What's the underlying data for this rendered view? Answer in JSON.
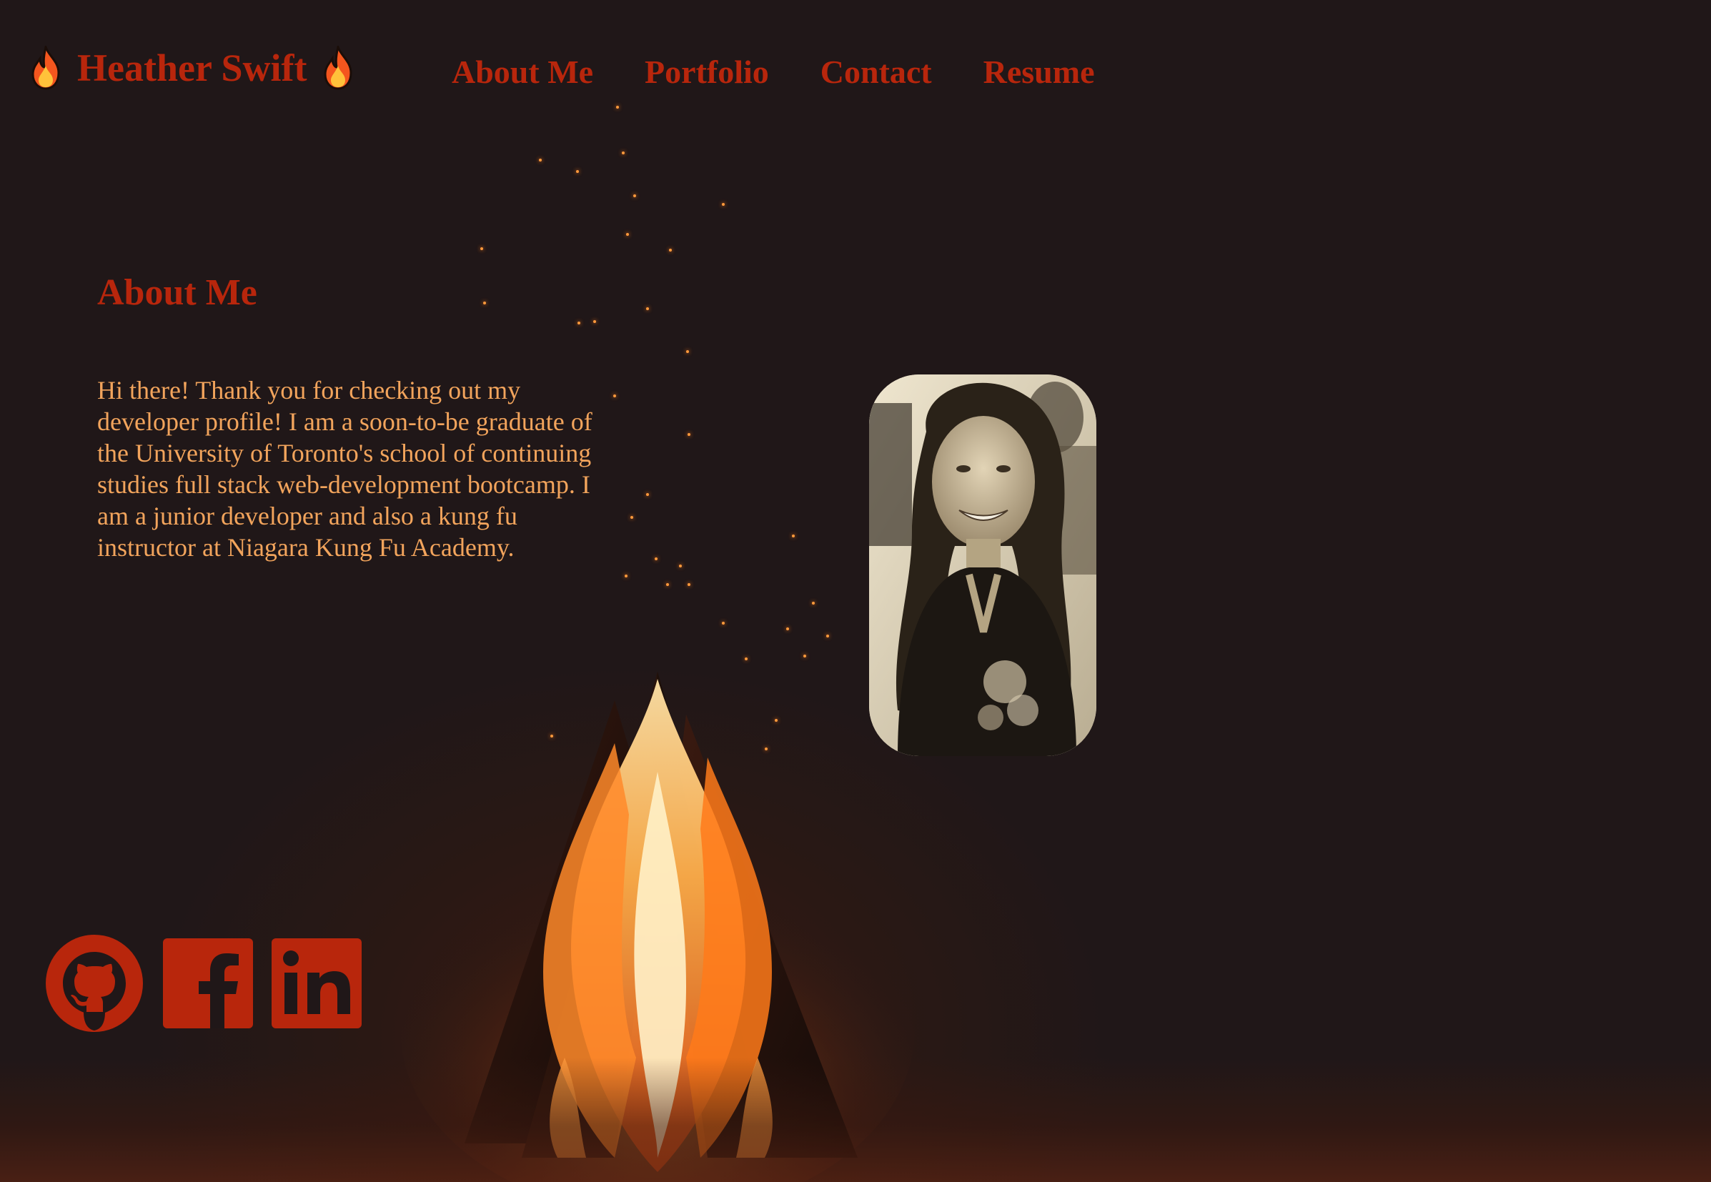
{
  "header": {
    "brand_name": "Heather Swift",
    "brand_icon": "fire-icon",
    "nav": [
      {
        "label": "About Me"
      },
      {
        "label": "Portfolio"
      },
      {
        "label": "Contact"
      },
      {
        "label": "Resume"
      }
    ]
  },
  "about": {
    "title": "About Me",
    "body": "Hi there! Thank you for checking out my developer profile! I am a soon-to-be graduate of the University of Toronto's school of continuing studies full stack web-development bootcamp. I am a junior developer and also a kung fu instructor at Niagara Kung Fu Academy."
  },
  "profile_photo": {
    "icon": "profile-photo"
  },
  "socials": [
    {
      "icon": "github-icon"
    },
    {
      "icon": "facebook-icon"
    },
    {
      "icon": "linkedin-icon"
    }
  ],
  "colors": {
    "background": "#201718",
    "accent": "#b8260c",
    "body_text": "#f2a45c"
  }
}
